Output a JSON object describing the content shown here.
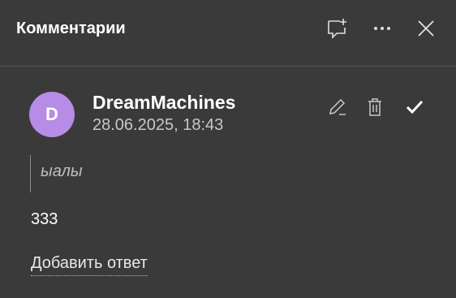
{
  "header": {
    "title": "Комментарии",
    "icons": [
      "add-comment-icon",
      "more-icon",
      "close-icon"
    ]
  },
  "comment": {
    "avatar_letter": "D",
    "avatar_color": "#b68ce6",
    "author": "DreamMachines",
    "date": "28.06.2025, 18:43",
    "quoted_text": "ыалы",
    "text": "333",
    "reply_label": "Добавить ответ",
    "actions": [
      "edit-icon",
      "delete-icon",
      "resolve-icon"
    ]
  }
}
